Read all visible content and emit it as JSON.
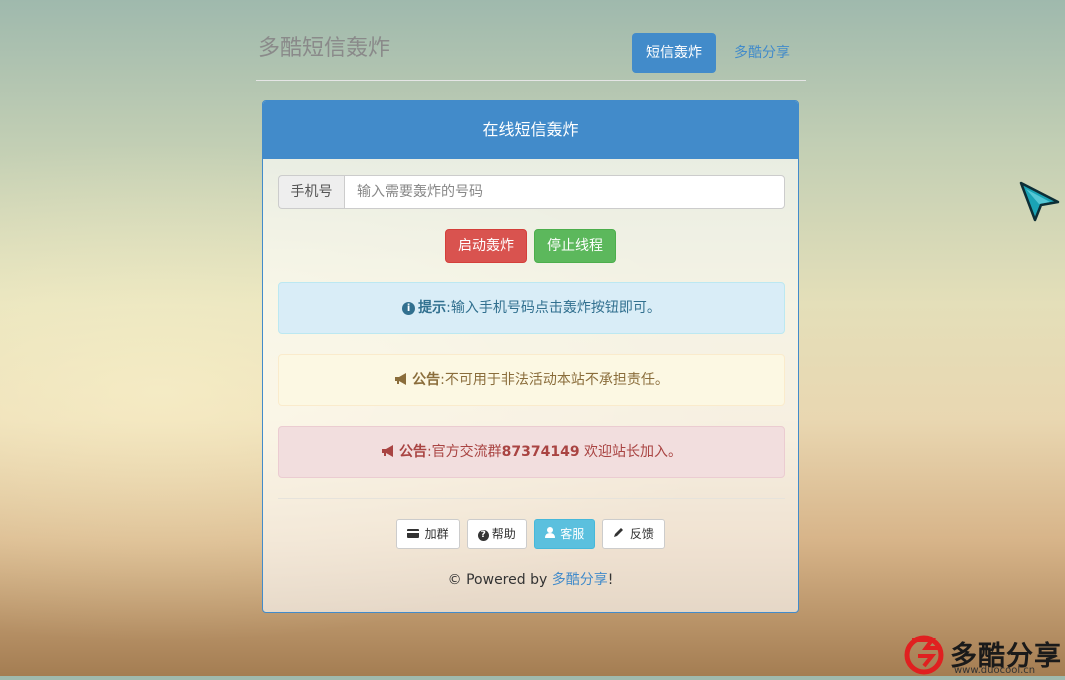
{
  "header": {
    "brand": "多酷短信轰炸",
    "nav_active": "短信轰炸",
    "nav_link": "多酷分享"
  },
  "panel": {
    "title": "在线短信轰炸",
    "phone_label": "手机号",
    "phone_placeholder": "输入需要轰炸的号码",
    "phone_value": "",
    "start_button": "启动轰炸",
    "stop_button": "停止线程"
  },
  "alerts": {
    "info": {
      "label": "提示",
      "text": ":输入手机号码点击轰炸按钮即可。"
    },
    "warning": {
      "label": "公告",
      "text": ":不可用于非法活动本站不承担责任。"
    },
    "danger": {
      "label": "公告",
      "text_prefix": ":官方交流群",
      "group_number": "87374149",
      "text_suffix": " 欢迎站长加入。"
    }
  },
  "tools": {
    "join": "加群",
    "help": "帮助",
    "service": "客服",
    "feedback": "反馈"
  },
  "footer": {
    "prefix": "© Powered by ",
    "link": "多酷分享",
    "suffix": "!"
  },
  "watermark": {
    "name": "多酷分享",
    "url": "www.duocool.cn"
  },
  "colors": {
    "primary": "#428bca",
    "danger": "#d9534f",
    "success": "#5cb85c",
    "info": "#5bc0de",
    "cursor": "#1aa3b5"
  }
}
